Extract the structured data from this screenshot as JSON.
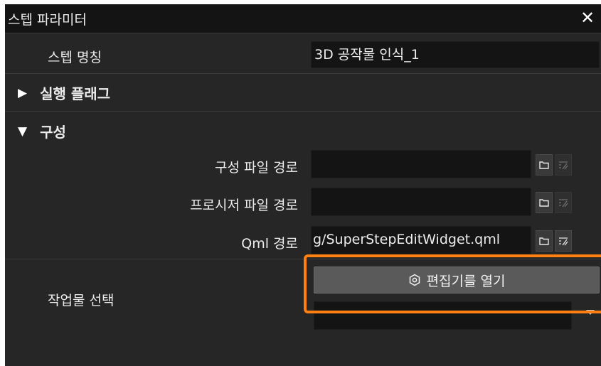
{
  "window": {
    "title": "스텝 파라미터",
    "close_icon": "close-icon"
  },
  "step_name": {
    "label": "스텝 명칭",
    "value": "3D 공작물 인식_1"
  },
  "run_flags": {
    "title": "실행 플래그",
    "expanded": false
  },
  "config": {
    "title": "구성",
    "expanded": true,
    "rows": [
      {
        "label": "구성 파일 경로",
        "value": ""
      },
      {
        "label": "프로시저 파일 경로",
        "value": ""
      },
      {
        "label": "Qml 경로",
        "value": "g/SuperStepEditWidget.qml"
      }
    ]
  },
  "workpiece": {
    "label": "작업물 선택",
    "open_editor_label": "편집기를 열기",
    "combo_value": ""
  },
  "colors": {
    "highlight": "#ff7f11",
    "panel_bg": "#262626",
    "field_bg": "#141414"
  }
}
